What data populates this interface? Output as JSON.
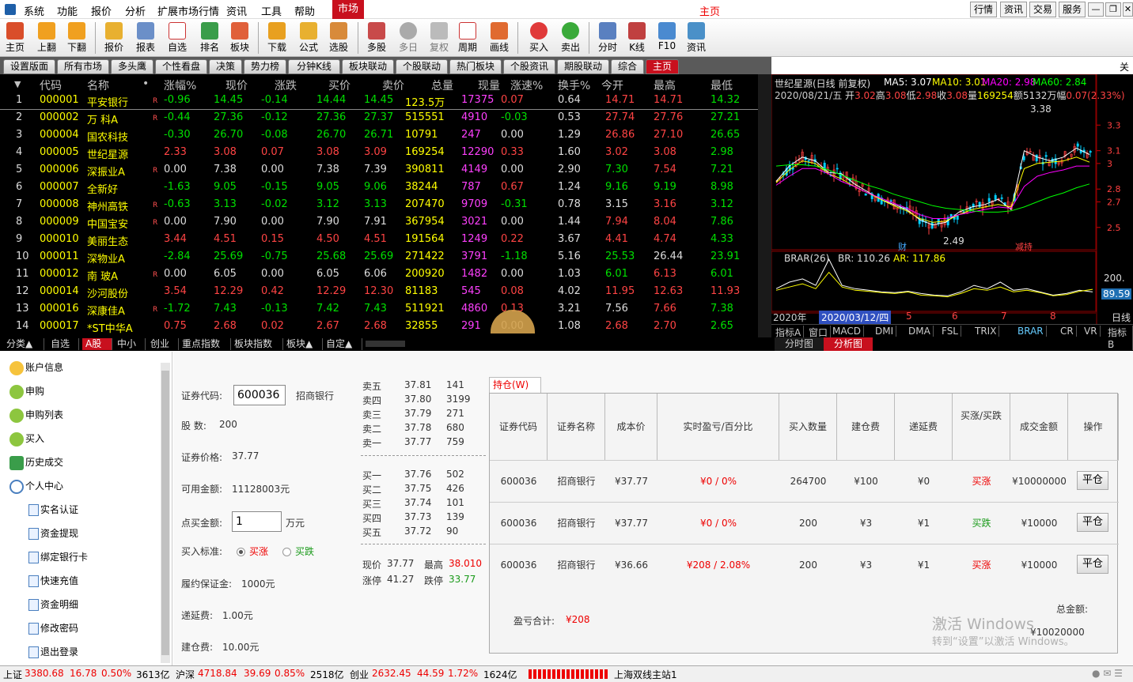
{
  "menubar": {
    "items": [
      "系统",
      "功能",
      "报价",
      "分析",
      "扩展市场行情",
      "资讯",
      "工具",
      "帮助"
    ],
    "market": "市场",
    "title": "主页",
    "right": [
      "行情",
      "资讯",
      "交易",
      "服务"
    ]
  },
  "toolbar": [
    "主页",
    "上翻",
    "下翻",
    "报价",
    "报表",
    "自选",
    "排名",
    "板块",
    "下载",
    "公式",
    "选股",
    "多股",
    "多日",
    "复权",
    "周期",
    "画线",
    "买入",
    "卖出",
    "分时",
    "K线",
    "F10",
    "资讯"
  ],
  "tabs": [
    "设置版面",
    "所有市场",
    "多头鹰",
    "个性看盘",
    "决策",
    "势力榜",
    "分钟K线",
    "板块联动",
    "个股联动",
    "热门板块",
    "个股资讯",
    "期股联动",
    "综合",
    "主页"
  ],
  "tabs_right": "关注",
  "quote": {
    "headers": [
      "代码",
      "名称",
      "•",
      "涨幅%",
      "现价",
      "涨跌",
      "买价",
      "卖价",
      "总量",
      "现量",
      "涨速%",
      "换手%",
      "今开",
      "最高",
      "最低"
    ],
    "rows": [
      {
        "n": "1",
        "code": "000001",
        "name": "平安银行",
        "r": "R",
        "pct": "-0.96",
        "price": "14.45",
        "chg": "-0.14",
        "bid": "14.44",
        "ask": "14.45",
        "vol": "123.5万",
        "cur": "17375",
        "spd": "0.07",
        "turn": "0.64",
        "open": "14.71",
        "high": "14.71",
        "low": "14.32"
      },
      {
        "n": "2",
        "code": "000002",
        "name": "万 科A",
        "r": "R",
        "pct": "-0.44",
        "price": "27.36",
        "chg": "-0.12",
        "bid": "27.36",
        "ask": "27.37",
        "vol": "515551",
        "cur": "4910",
        "spd": "-0.03",
        "turn": "0.53",
        "open": "27.74",
        "high": "27.76",
        "low": "27.21"
      },
      {
        "n": "3",
        "code": "000004",
        "name": "国农科技",
        "r": "",
        "pct": "-0.30",
        "price": "26.70",
        "chg": "-0.08",
        "bid": "26.70",
        "ask": "26.71",
        "vol": "10791",
        "cur": "247",
        "spd": "0.00",
        "turn": "1.29",
        "open": "26.86",
        "high": "27.10",
        "low": "26.65"
      },
      {
        "n": "4",
        "code": "000005",
        "name": "世纪星源",
        "r": "",
        "pct": "2.33",
        "price": "3.08",
        "chg": "0.07",
        "bid": "3.08",
        "ask": "3.09",
        "vol": "169254",
        "cur": "12290",
        "spd": "0.33",
        "turn": "1.60",
        "open": "3.02",
        "high": "3.08",
        "low": "2.98"
      },
      {
        "n": "5",
        "code": "000006",
        "name": "深振业A",
        "r": "R",
        "pct": "0.00",
        "price": "7.38",
        "chg": "0.00",
        "bid": "7.38",
        "ask": "7.39",
        "vol": "390811",
        "cur": "4149",
        "spd": "0.00",
        "turn": "2.90",
        "open": "7.30",
        "high": "7.54",
        "low": "7.21"
      },
      {
        "n": "6",
        "code": "000007",
        "name": "全新好",
        "r": "",
        "pct": "-1.63",
        "price": "9.05",
        "chg": "-0.15",
        "bid": "9.05",
        "ask": "9.06",
        "vol": "38244",
        "cur": "787",
        "spd": "0.67",
        "turn": "1.24",
        "open": "9.16",
        "high": "9.19",
        "low": "8.98"
      },
      {
        "n": "7",
        "code": "000008",
        "name": "神州高铁",
        "r": "R",
        "pct": "-0.63",
        "price": "3.13",
        "chg": "-0.02",
        "bid": "3.12",
        "ask": "3.13",
        "vol": "207470",
        "cur": "9709",
        "spd": "-0.31",
        "turn": "0.78",
        "open": "3.15",
        "high": "3.16",
        "low": "3.12"
      },
      {
        "n": "8",
        "code": "000009",
        "name": "中国宝安",
        "r": "R",
        "pct": "0.00",
        "price": "7.90",
        "chg": "0.00",
        "bid": "7.90",
        "ask": "7.91",
        "vol": "367954",
        "cur": "3021",
        "spd": "0.00",
        "turn": "1.44",
        "open": "7.94",
        "high": "8.04",
        "low": "7.86"
      },
      {
        "n": "9",
        "code": "000010",
        "name": "美丽生态",
        "r": "",
        "pct": "3.44",
        "price": "4.51",
        "chg": "0.15",
        "bid": "4.50",
        "ask": "4.51",
        "vol": "191564",
        "cur": "1249",
        "spd": "0.22",
        "turn": "3.67",
        "open": "4.41",
        "high": "4.74",
        "low": "4.33"
      },
      {
        "n": "10",
        "code": "000011",
        "name": "深物业A",
        "r": "",
        "pct": "-2.84",
        "price": "25.69",
        "chg": "-0.75",
        "bid": "25.68",
        "ask": "25.69",
        "vol": "271422",
        "cur": "3791",
        "spd": "-1.18",
        "turn": "5.16",
        "open": "25.53",
        "high": "26.44",
        "low": "23.91"
      },
      {
        "n": "11",
        "code": "000012",
        "name": "南 玻A",
        "r": "R",
        "pct": "0.00",
        "price": "6.05",
        "chg": "0.00",
        "bid": "6.05",
        "ask": "6.06",
        "vol": "200920",
        "cur": "1482",
        "spd": "0.00",
        "turn": "1.03",
        "open": "6.01",
        "high": "6.13",
        "low": "6.01"
      },
      {
        "n": "12",
        "code": "000014",
        "name": "沙河股份",
        "r": "",
        "pct": "3.54",
        "price": "12.29",
        "chg": "0.42",
        "bid": "12.29",
        "ask": "12.30",
        "vol": "81183",
        "cur": "545",
        "spd": "0.08",
        "turn": "4.02",
        "open": "11.95",
        "high": "12.63",
        "low": "11.93"
      },
      {
        "n": "13",
        "code": "000016",
        "name": "深康佳A",
        "r": "R",
        "pct": "-1.72",
        "price": "7.43",
        "chg": "-0.13",
        "bid": "7.42",
        "ask": "7.43",
        "vol": "511921",
        "cur": "4860",
        "spd": "0.13",
        "turn": "3.21",
        "open": "7.56",
        "high": "7.66",
        "low": "7.38"
      },
      {
        "n": "14",
        "code": "000017",
        "name": "*ST中华A",
        "r": "",
        "pct": "0.75",
        "price": "2.68",
        "chg": "0.02",
        "bid": "2.67",
        "ask": "2.68",
        "vol": "32855",
        "cur": "291",
        "spd": "0.00",
        "turn": "1.08",
        "open": "2.68",
        "high": "2.70",
        "low": "2.65"
      }
    ]
  },
  "sheet_tabs": [
    "分类▲",
    "自选",
    "A股",
    "中小",
    "创业",
    "重点指数",
    "板块指数",
    "板块▲",
    "自定▲"
  ],
  "chart": {
    "title": "世纪星源(日线 前复权)",
    "ma": [
      {
        "t": "MA5: 3.07",
        "c": "#ffffff"
      },
      {
        "t": "MA10: 3.01",
        "c": "#ffff00"
      },
      {
        "t": "MA20: 2.98",
        "c": "#ff00ff"
      },
      {
        "t": "MA60: 2.84",
        "c": "#00ff00"
      }
    ],
    "info_date": "2020/08/21/五",
    "info": [
      {
        "k": "开",
        "v": "3.02"
      },
      {
        "k": "高",
        "v": "3.08"
      },
      {
        "k": "低",
        "v": "2.98"
      },
      {
        "k": "收",
        "v": "3.08"
      },
      {
        "k": "量",
        "v": "169254"
      },
      {
        "k": "额",
        "v": "5132万"
      },
      {
        "k": "幅",
        "v": "0.07(2.33%)"
      }
    ],
    "high_label": "3.38",
    "low_label": "2.49",
    "marker_cai": "财",
    "marker_xi": "减持",
    "ind_title": "BRAR(26)",
    "br": "BR: 110.26",
    "ar": "AR: 117.86",
    "ind_axis": [
      "200."
    ],
    "ind_cur": "89.59",
    "date_label": "2020/03/12/四",
    "year_label": "2020年",
    "months": [
      "5",
      "6",
      "7",
      "8"
    ],
    "period": "日线",
    "ind_tabs": [
      "指标A",
      "窗口",
      "MACD",
      "DMI",
      "DMA",
      "FSL",
      "TRIX",
      "BRAR",
      "CR",
      "VR",
      "指标B",
      "模",
      "板"
    ],
    "bottom_tabs": [
      "分时图",
      "分析图"
    ]
  },
  "chart_data": {
    "type": "line",
    "title": "世纪星源(日线 前复权)",
    "yticks": [
      3.3,
      3.1,
      3.0,
      2.8,
      2.7,
      2.5
    ],
    "ylim": [
      2.4,
      3.45
    ],
    "series": [
      {
        "name": "MA5",
        "values": [
          2.86,
          2.98,
          3.05,
          3.02,
          2.93,
          2.92,
          2.84,
          2.78,
          2.72,
          2.68,
          2.64,
          2.56,
          2.52,
          2.54,
          2.62,
          2.66,
          2.68,
          2.72,
          2.64,
          3.1,
          3.05,
          3.02,
          3.05,
          3.12,
          3.07
        ]
      },
      {
        "name": "MA10",
        "values": [
          2.85,
          2.95,
          3.02,
          3.0,
          2.92,
          2.88,
          2.82,
          2.77,
          2.72,
          2.67,
          2.63,
          2.57,
          2.54,
          2.55,
          2.6,
          2.64,
          2.66,
          2.68,
          2.66,
          2.96,
          3.0,
          3.01,
          3.02,
          3.05,
          3.01
        ]
      },
      {
        "name": "MA20",
        "values": [
          2.83,
          2.9,
          2.96,
          2.96,
          2.92,
          2.86,
          2.82,
          2.77,
          2.73,
          2.69,
          2.65,
          2.6,
          2.57,
          2.57,
          2.6,
          2.62,
          2.64,
          2.66,
          2.65,
          2.82,
          2.9,
          2.93,
          2.95,
          2.98,
          2.98
        ]
      },
      {
        "name": "MA60",
        "values": [
          2.98,
          2.99,
          2.99,
          2.98,
          2.95,
          2.91,
          2.87,
          2.83,
          2.8,
          2.76,
          2.73,
          2.7,
          2.67,
          2.65,
          2.64,
          2.63,
          2.62,
          2.62,
          2.63,
          2.66,
          2.7,
          2.74,
          2.77,
          2.81,
          2.84
        ]
      }
    ]
  },
  "side": {
    "items": [
      "账户信息",
      "申购",
      "申购列表",
      "买入",
      "历史成交",
      "个人中心"
    ],
    "sub": [
      "实名认证",
      "资金提现",
      "绑定银行卡",
      "快速充值",
      "资金明细",
      "修改密码",
      "退出登录"
    ]
  },
  "form": {
    "code_label": "证券代码:",
    "code": "600036",
    "name": "招商银行",
    "shares_label": "股 数:",
    "shares": "200",
    "price_label": "证券价格:",
    "price": "37.77",
    "avail_label": "可用金额:",
    "avail": "11128003元",
    "buy_label": "点买金额:",
    "buy": "1",
    "buy_unit": "万元",
    "std_label": "买入标准:",
    "std_up": "买涨",
    "std_down": "买跌",
    "margin_label": "履约保证金:",
    "margin": "1000元",
    "defer_label": "递延费:",
    "defer": "1.00元",
    "open_label": "建仓费:",
    "open": "10.00元"
  },
  "book": {
    "asks": [
      {
        "l": "卖五",
        "p": "37.81",
        "v": "141"
      },
      {
        "l": "卖四",
        "p": "37.80",
        "v": "3199"
      },
      {
        "l": "卖三",
        "p": "37.79",
        "v": "271"
      },
      {
        "l": "卖二",
        "p": "37.78",
        "v": "680"
      },
      {
        "l": "卖一",
        "p": "37.77",
        "v": "759"
      }
    ],
    "bids": [
      {
        "l": "买一",
        "p": "37.76",
        "v": "502"
      },
      {
        "l": "买二",
        "p": "37.75",
        "v": "426"
      },
      {
        "l": "买三",
        "p": "37.74",
        "v": "101"
      },
      {
        "l": "买四",
        "p": "37.73",
        "v": "139"
      },
      {
        "l": "买五",
        "p": "37.72",
        "v": "90"
      }
    ],
    "now_l": "现价",
    "now": "37.77",
    "hi_l": "最高",
    "hi": "38.010",
    "up_l": "涨停",
    "up": "41.27",
    "dn_l": "跌停",
    "dn": "33.77"
  },
  "hold": {
    "tab": "持仓(W)",
    "headers": [
      "证券代码",
      "证券名称",
      "成本价",
      "实时盈亏/百分比",
      "买入数量",
      "建仓费",
      "递延费",
      "买涨/买跌",
      "成交金额",
      "操作"
    ],
    "rows": [
      {
        "code": "600036",
        "name": "招商银行",
        "cost": "¥37.77",
        "pl": "¥0 / 0%",
        "qty": "264700",
        "fee": "¥100",
        "defer": "¥0",
        "dir": "买涨",
        "amt": "¥10000000",
        "op": "平仓"
      },
      {
        "code": "600036",
        "name": "招商银行",
        "cost": "¥37.77",
        "pl": "¥0 / 0%",
        "qty": "200",
        "fee": "¥3",
        "defer": "¥1",
        "dir": "买跌",
        "amt": "¥10000",
        "op": "平仓"
      },
      {
        "code": "600036",
        "name": "招商银行",
        "cost": "¥36.66",
        "pl": "¥208 / 2.08%",
        "qty": "200",
        "fee": "¥3",
        "defer": "¥1",
        "dir": "买涨",
        "amt": "¥10000",
        "op": "平仓"
      }
    ],
    "pl_label": "盈亏合计:",
    "pl_total": "¥208",
    "total_label": "总金额:",
    "total": "¥10020000"
  },
  "watermark": {
    "line1": "激活 Windows",
    "line2": "转到“设置”以激活 Windows。"
  },
  "status": {
    "idx": [
      {
        "n": "上证",
        "v": "3380.68",
        "c": "16.78",
        "p": "0.50%",
        "a": "3613亿"
      },
      {
        "n": "沪深",
        "v": "4718.84",
        "c": "39.69",
        "p": "0.85%",
        "a": "2518亿"
      },
      {
        "n": "创业",
        "v": "2632.45",
        "c": "44.59",
        "p": "1.72%",
        "a": "1624亿"
      }
    ],
    "server": "上海双线主站1"
  }
}
